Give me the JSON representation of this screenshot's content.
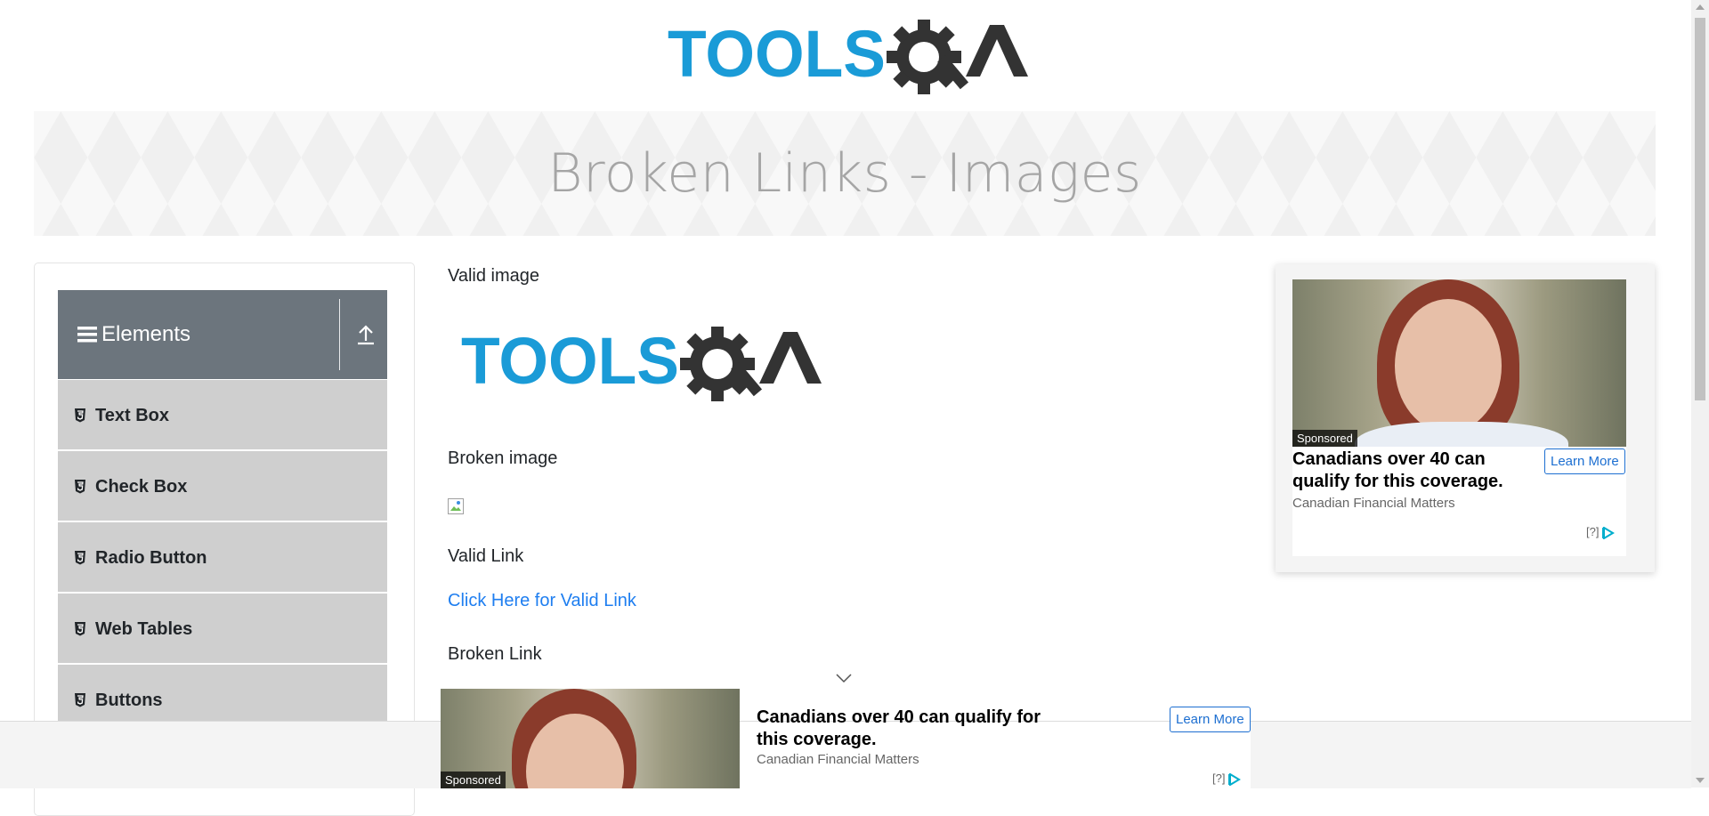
{
  "logo": {
    "text_part": "TOOLS",
    "accent_part": "QA",
    "brand_blue": "#1a9bd7",
    "brand_dark": "#333333"
  },
  "banner": {
    "title": "Broken Links - Images"
  },
  "sidebar": {
    "group_title": "Elements",
    "group_icon": "hamburger-icon",
    "collapse_icon": "arrow-up-icon",
    "items": [
      {
        "label": "Text Box",
        "icon": "html5-icon"
      },
      {
        "label": "Check Box",
        "icon": "html5-icon"
      },
      {
        "label": "Radio Button",
        "icon": "html5-icon"
      },
      {
        "label": "Web Tables",
        "icon": "html5-icon"
      },
      {
        "label": "Buttons",
        "icon": "html5-icon"
      }
    ]
  },
  "main": {
    "valid_image_label": "Valid image",
    "broken_image_label": "Broken image",
    "valid_link_label": "Valid Link",
    "valid_link_text": "Click Here for Valid Link",
    "broken_link_label": "Broken Link",
    "link_color": "#1e7ef0"
  },
  "side_ad": {
    "badge": "Sponsored",
    "headline": "Canadians over 40 can qualify for this coverage.",
    "source": "Canadian Financial Matters",
    "button": "Learn More",
    "adchoice": "[?]"
  },
  "bottom_ad": {
    "badge": "Sponsored",
    "headline": "Canadians over 40 can qualify for this coverage.",
    "source": "Canadian Financial Matters",
    "button": "Learn More",
    "adchoice": "[?]"
  }
}
